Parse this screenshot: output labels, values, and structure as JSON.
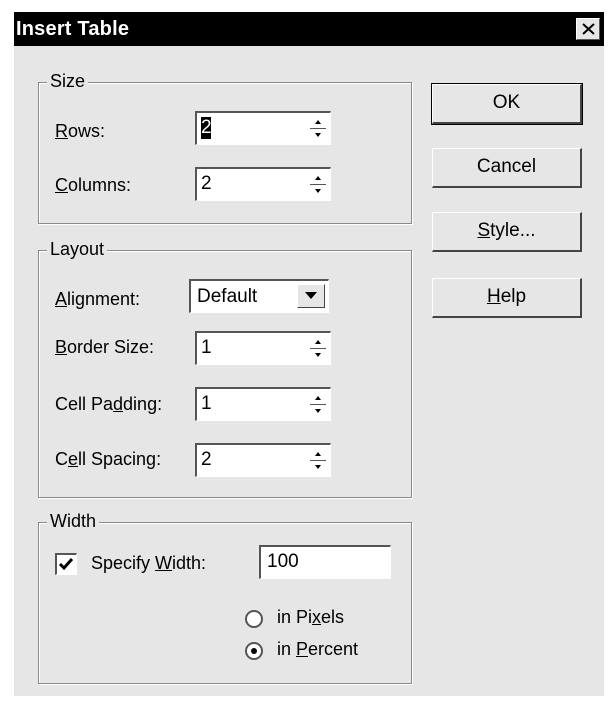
{
  "dialog": {
    "title": "Insert Table",
    "close_glyph": "✕"
  },
  "size": {
    "legend": "Size",
    "rows_label_ul": "R",
    "rows_label_rest": "ows:",
    "rows_value": "2",
    "columns_label_ul": "C",
    "columns_label_rest": "olumns:",
    "columns_value": "2"
  },
  "layout": {
    "legend": "Layout",
    "alignment_label_ul": "A",
    "alignment_label_rest": "lignment:",
    "alignment_value": "Default",
    "border_label_ul": "B",
    "border_label_rest": "order Size:",
    "border_value": "1",
    "padding_label_a": "Cell Pa",
    "padding_label_ul": "d",
    "padding_label_b": "ding:",
    "padding_value": "1",
    "spacing_label_a": "C",
    "spacing_label_ul": "e",
    "spacing_label_b": "ll Spacing:",
    "spacing_value": "2"
  },
  "width": {
    "legend": "Width",
    "specify_label_a": "Specify ",
    "specify_label_ul": "W",
    "specify_label_b": "idth:",
    "specify_checked": true,
    "width_value": "100",
    "pixels_label_a": "in Pi",
    "pixels_label_ul": "x",
    "pixels_label_b": "els",
    "percent_label_a": "in ",
    "percent_label_ul": "P",
    "percent_label_b": "ercent",
    "selected_unit": "percent"
  },
  "buttons": {
    "ok": "OK",
    "cancel": "Cancel",
    "style_ul": "S",
    "style_rest": "tyle...",
    "help_ul": "H",
    "help_rest": "elp"
  },
  "icons": {
    "close": "close-icon",
    "spin_up": "arrow-up-icon",
    "spin_down": "arrow-down-icon",
    "dropdown": "chevron-down-icon",
    "checkmark": "checkmark-icon"
  }
}
